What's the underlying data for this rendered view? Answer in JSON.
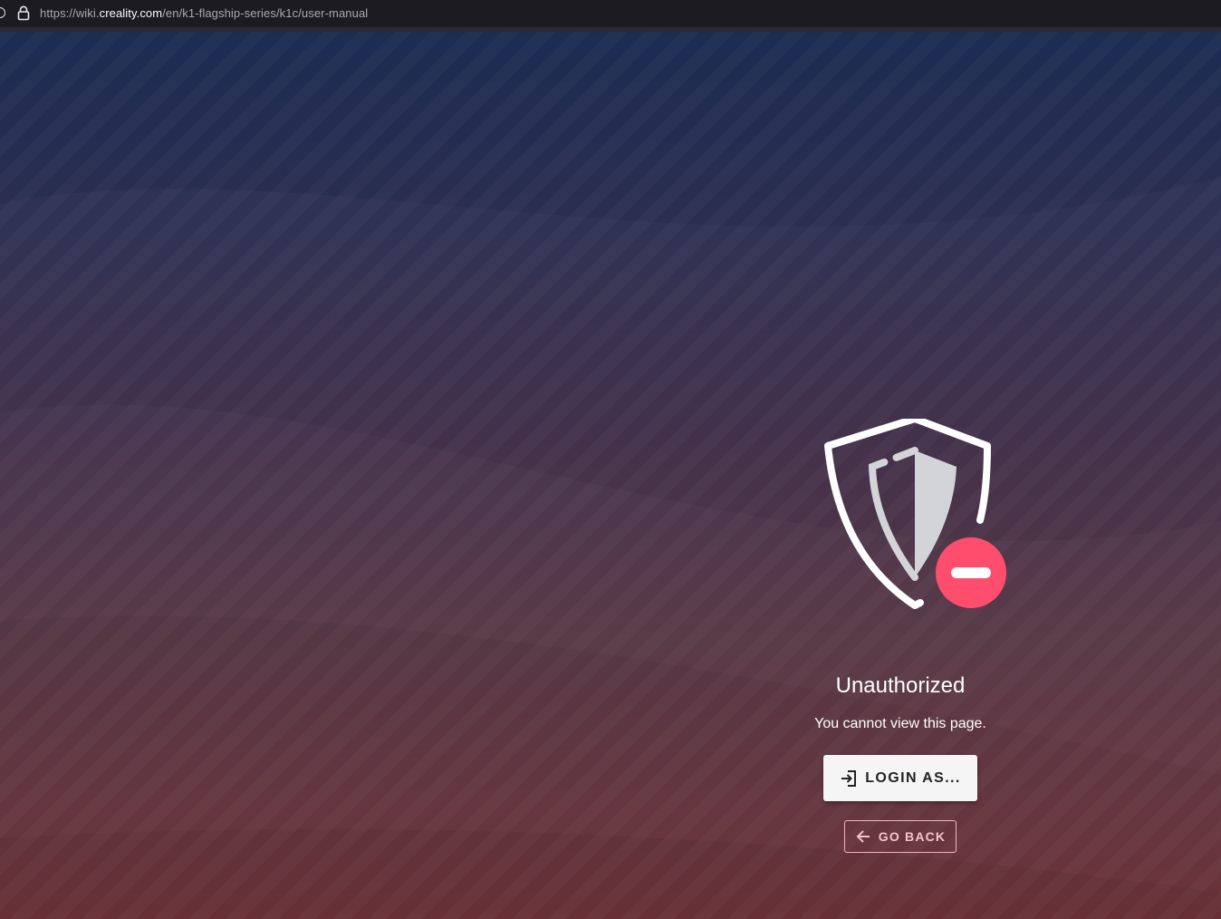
{
  "browser": {
    "url_scheme": "https://wiki.",
    "url_host": "creality.com",
    "url_path": "/en/k1-flagship-series/k1c/user-manual"
  },
  "error": {
    "icon": "shield-blocked-icon",
    "title": "Unauthorized",
    "message": "You cannot view this page.",
    "login_label": "LOGIN AS...",
    "login_icon": "login-icon",
    "back_label": "GO BACK",
    "back_icon": "arrow-left-icon"
  },
  "colors": {
    "badge": "#ff4d6d",
    "shield_fill": "#d3d4d8",
    "back_border": "#f8b3c0"
  }
}
